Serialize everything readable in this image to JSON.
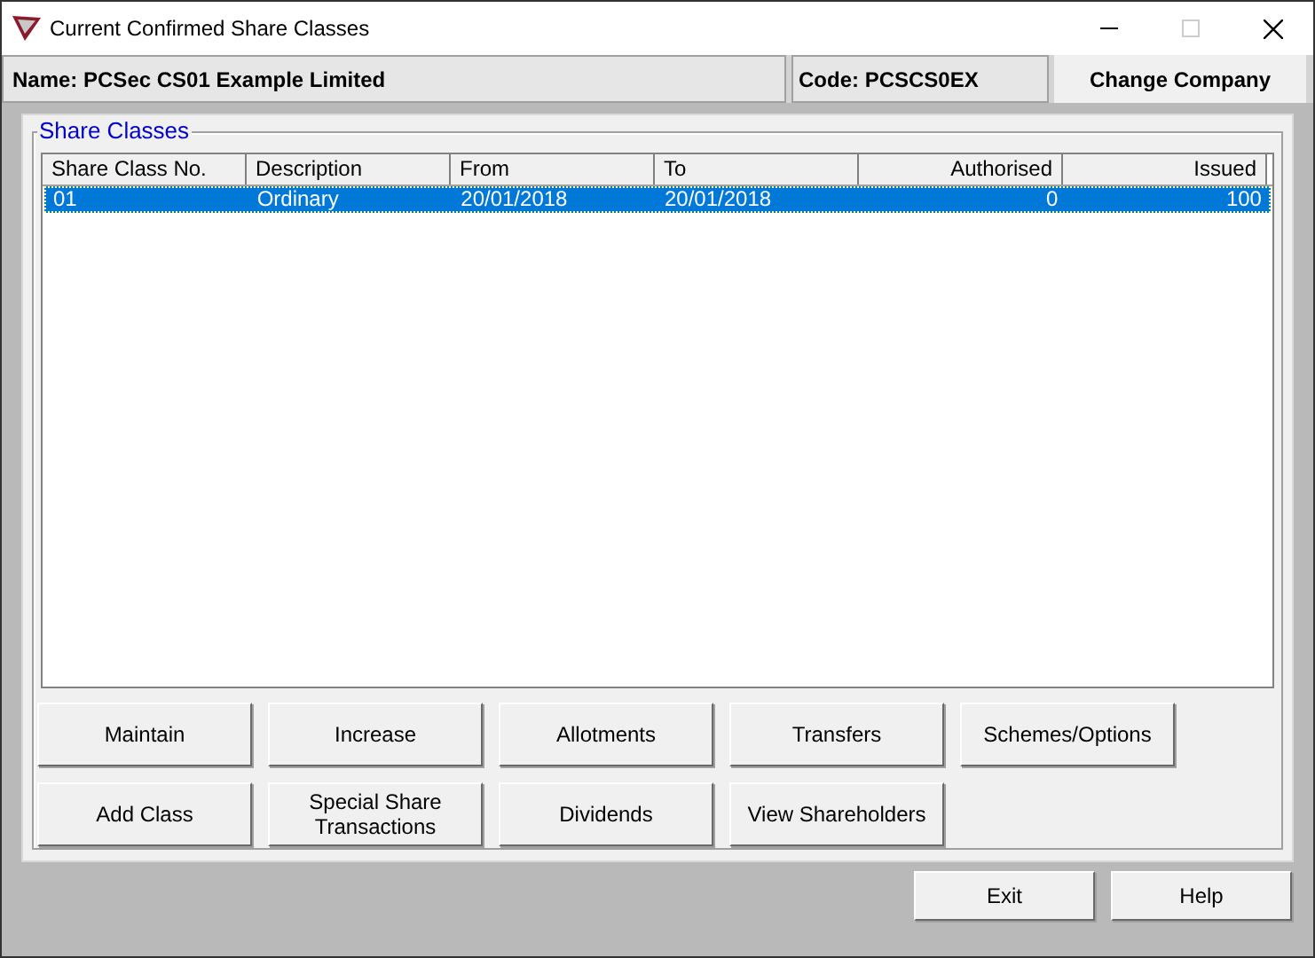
{
  "window": {
    "title": "Current Confirmed Share Classes"
  },
  "company": {
    "name": "Name: PCSec CS01 Example Limited",
    "code": "Code: PCSCS0EX",
    "change_button": "Change Company"
  },
  "group": {
    "title": "Share Classes"
  },
  "table": {
    "columns": [
      {
        "label": "Share Class No.",
        "right_aligned": false
      },
      {
        "label": "Description",
        "right_aligned": false
      },
      {
        "label": "From",
        "right_aligned": false
      },
      {
        "label": "To",
        "right_aligned": false
      },
      {
        "label": "Authorised",
        "right_aligned": true
      },
      {
        "label": "Issued",
        "right_aligned": true
      }
    ],
    "rows": [
      {
        "selected": true,
        "cells": [
          "01",
          "Ordinary",
          "20/01/2018",
          "20/01/2018",
          "0",
          "100"
        ]
      }
    ]
  },
  "actions": [
    {
      "label": "Maintain"
    },
    {
      "label": "Increase"
    },
    {
      "label": "Allotments"
    },
    {
      "label": "Transfers"
    },
    {
      "label": "Schemes/Options"
    },
    {
      "label": "Add Class"
    },
    {
      "label": "Special Share Transactions"
    },
    {
      "label": "Dividends"
    },
    {
      "label": "View Shareholders"
    }
  ],
  "footer_buttons": [
    {
      "label": "Exit"
    },
    {
      "label": "Help"
    }
  ]
}
